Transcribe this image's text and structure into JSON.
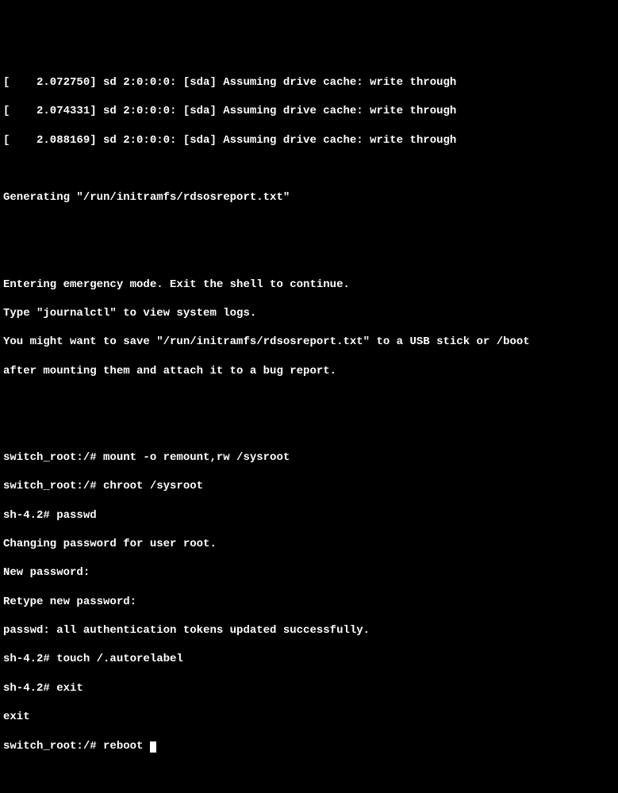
{
  "boot_messages": [
    "[    2.072750] sd 2:0:0:0: [sda] Assuming drive cache: write through",
    "[    2.074331] sd 2:0:0:0: [sda] Assuming drive cache: write through",
    "[    2.088169] sd 2:0:0:0: [sda] Assuming drive cache: write through"
  ],
  "generating_msg": "Generating \"/run/initramfs/rdsosreport.txt\"",
  "emergency_block": [
    "Entering emergency mode. Exit the shell to continue.",
    "Type \"journalctl\" to view system logs.",
    "You might want to save \"/run/initramfs/rdsosreport.txt\" to a USB stick or /boot",
    "after mounting them and attach it to a bug report."
  ],
  "session_lines": [
    "switch_root:/# mount -o remount,rw /sysroot",
    "switch_root:/# chroot /sysroot",
    "sh-4.2# passwd",
    "Changing password for user root.",
    "New password:",
    "Retype new password:",
    "passwd: all authentication tokens updated successfully.",
    "sh-4.2# touch /.autorelabel",
    "sh-4.2# exit",
    "exit",
    "switch_root:/# reboot"
  ]
}
